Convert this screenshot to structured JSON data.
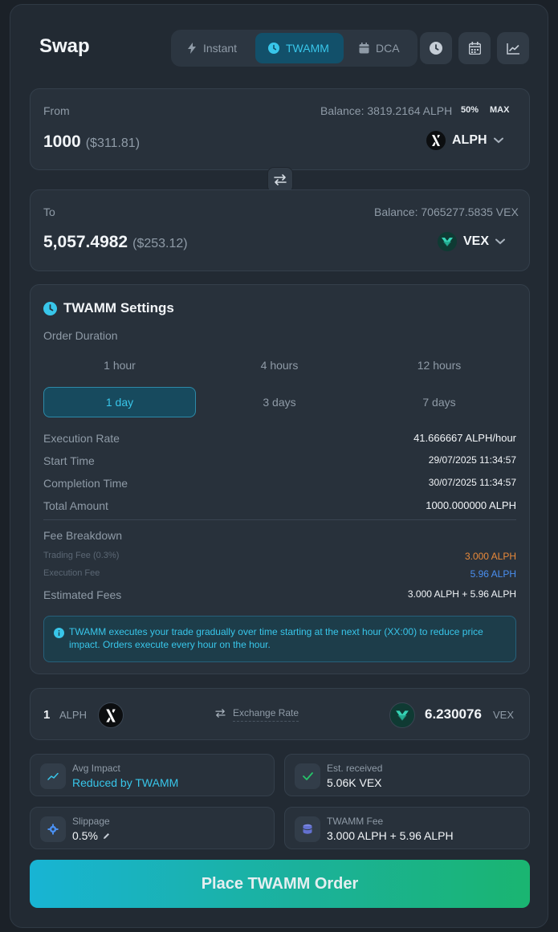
{
  "header": {
    "title": "Swap"
  },
  "modes": [
    {
      "label": "Instant",
      "icon": "lightning-icon"
    },
    {
      "label": "TWAMM",
      "icon": "clock-icon"
    },
    {
      "label": "DCA",
      "icon": "calendar-icon"
    }
  ],
  "from": {
    "label": "From",
    "balance": "Balance: 3819.2164 ALPH",
    "pct50": "50%",
    "max": "MAX",
    "amount": "1000",
    "usd": "($311.81)",
    "token": "ALPH"
  },
  "to": {
    "label": "To",
    "balance": "Balance: 7065277.5835 VEX",
    "amount": "5,057.4982",
    "usd": "($253.12)",
    "token": "VEX"
  },
  "twamm": {
    "title": "TWAMM Settings",
    "duration_label": "Order Duration",
    "durations": [
      "1 hour",
      "4 hours",
      "12 hours",
      "1 day",
      "3 days",
      "7 days"
    ],
    "selected_duration": "1 day",
    "rows": [
      {
        "label": "Execution Rate",
        "value": "41.666667 ALPH/hour"
      },
      {
        "label": "Start Time",
        "value": "29/07/2025 11:34:57"
      },
      {
        "label": "Completion Time",
        "value": "30/07/2025 11:34:57"
      },
      {
        "label": "Total Amount",
        "value": "1000.000000 ALPH"
      }
    ],
    "fee_breakdown": "Fee Breakdown",
    "trading_fee_label": "Trading Fee (0.3%)",
    "trading_fee_value": "3.000 ALPH",
    "execution_fee_label": "Execution Fee",
    "execution_fee_value": "5.96 ALPH",
    "estimated_fees_label": "Estimated Fees",
    "estimated_fees_value": "3.000 ALPH + 5.96 ALPH",
    "info": "TWAMM executes your trade gradually over time starting at the next hour (XX:00) to reduce price impact. Orders execute every hour on the hour."
  },
  "rate": {
    "left_amount": "1",
    "left_token": "ALPH",
    "label": "Exchange Rate",
    "right_amount": "6.230076",
    "right_token": "VEX"
  },
  "stats": {
    "impact_label": "Avg Impact",
    "impact_value": "Reduced by TWAMM",
    "received_label": "Est. received",
    "received_value": "5.06K VEX",
    "slippage_label": "Slippage",
    "slippage_value": "0.5%",
    "fee_label": "TWAMM Fee",
    "fee_value": "3.000 ALPH + 5.96 ALPH"
  },
  "cta": {
    "label": "Place TWAMM Order"
  },
  "colors": {
    "accent": "#38c6ea",
    "orange": "#e8893a",
    "blue": "#4a8ff0",
    "green": "#26c46a"
  }
}
